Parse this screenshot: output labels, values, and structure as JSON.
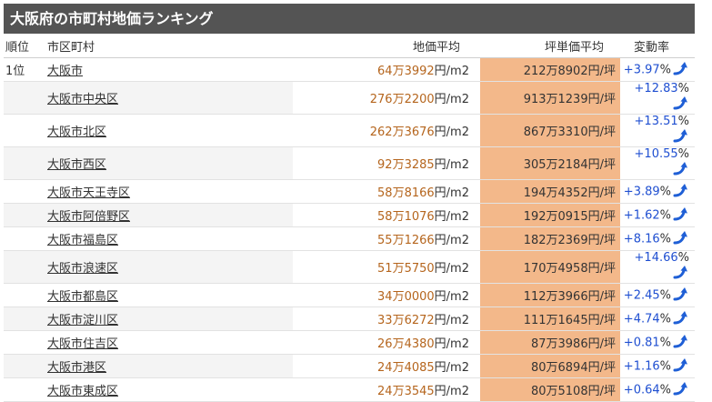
{
  "title": "大阪府の市町村地価ランキング",
  "headers": {
    "rank": "順位",
    "city": "市区町村",
    "land_price": "地価平均",
    "tsubo_price": "坪単価平均",
    "change": "変動率"
  },
  "units": {
    "land": "円/m2",
    "tsubo": "円/坪",
    "change": "%"
  },
  "colors": {
    "title_bg": "#545454",
    "tsubo_bg": "#f3b88a",
    "land_text": "#b5651d",
    "change_text": "#1f4fd1",
    "arrow": "#1f5fd6"
  },
  "icons": {
    "trend": "trend-up-arrow-icon"
  },
  "rows": [
    {
      "rank": "1位",
      "city": "大阪市",
      "land": "64万3992",
      "tsubo": "212万8902",
      "change": "+3.97"
    },
    {
      "rank": "",
      "city": "大阪市中央区",
      "land": "276万2200",
      "tsubo": "913万1239",
      "change": "+12.83"
    },
    {
      "rank": "",
      "city": "大阪市北区",
      "land": "262万3676",
      "tsubo": "867万3310",
      "change": "+13.51"
    },
    {
      "rank": "",
      "city": "大阪市西区",
      "land": "92万3285",
      "tsubo": "305万2184",
      "change": "+10.55"
    },
    {
      "rank": "",
      "city": "大阪市天王寺区",
      "land": "58万8166",
      "tsubo": "194万4352",
      "change": "+3.89"
    },
    {
      "rank": "",
      "city": "大阪市阿倍野区",
      "land": "58万1076",
      "tsubo": "192万0915",
      "change": "+1.62"
    },
    {
      "rank": "",
      "city": "大阪市福島区",
      "land": "55万1266",
      "tsubo": "182万2369",
      "change": "+8.16"
    },
    {
      "rank": "",
      "city": "大阪市浪速区",
      "land": "51万5750",
      "tsubo": "170万4958",
      "change": "+14.66"
    },
    {
      "rank": "",
      "city": "大阪市都島区",
      "land": "34万0000",
      "tsubo": "112万3966",
      "change": "+2.45"
    },
    {
      "rank": "",
      "city": "大阪市淀川区",
      "land": "33万6272",
      "tsubo": "111万1645",
      "change": "+4.74"
    },
    {
      "rank": "",
      "city": "大阪市住吉区",
      "land": "26万4380",
      "tsubo": "87万3986",
      "change": "+0.81"
    },
    {
      "rank": "",
      "city": "大阪市港区",
      "land": "24万4085",
      "tsubo": "80万6894",
      "change": "+1.16"
    },
    {
      "rank": "",
      "city": "大阪市東成区",
      "land": "24万3545",
      "tsubo": "80万5108",
      "change": "+0.64"
    }
  ]
}
